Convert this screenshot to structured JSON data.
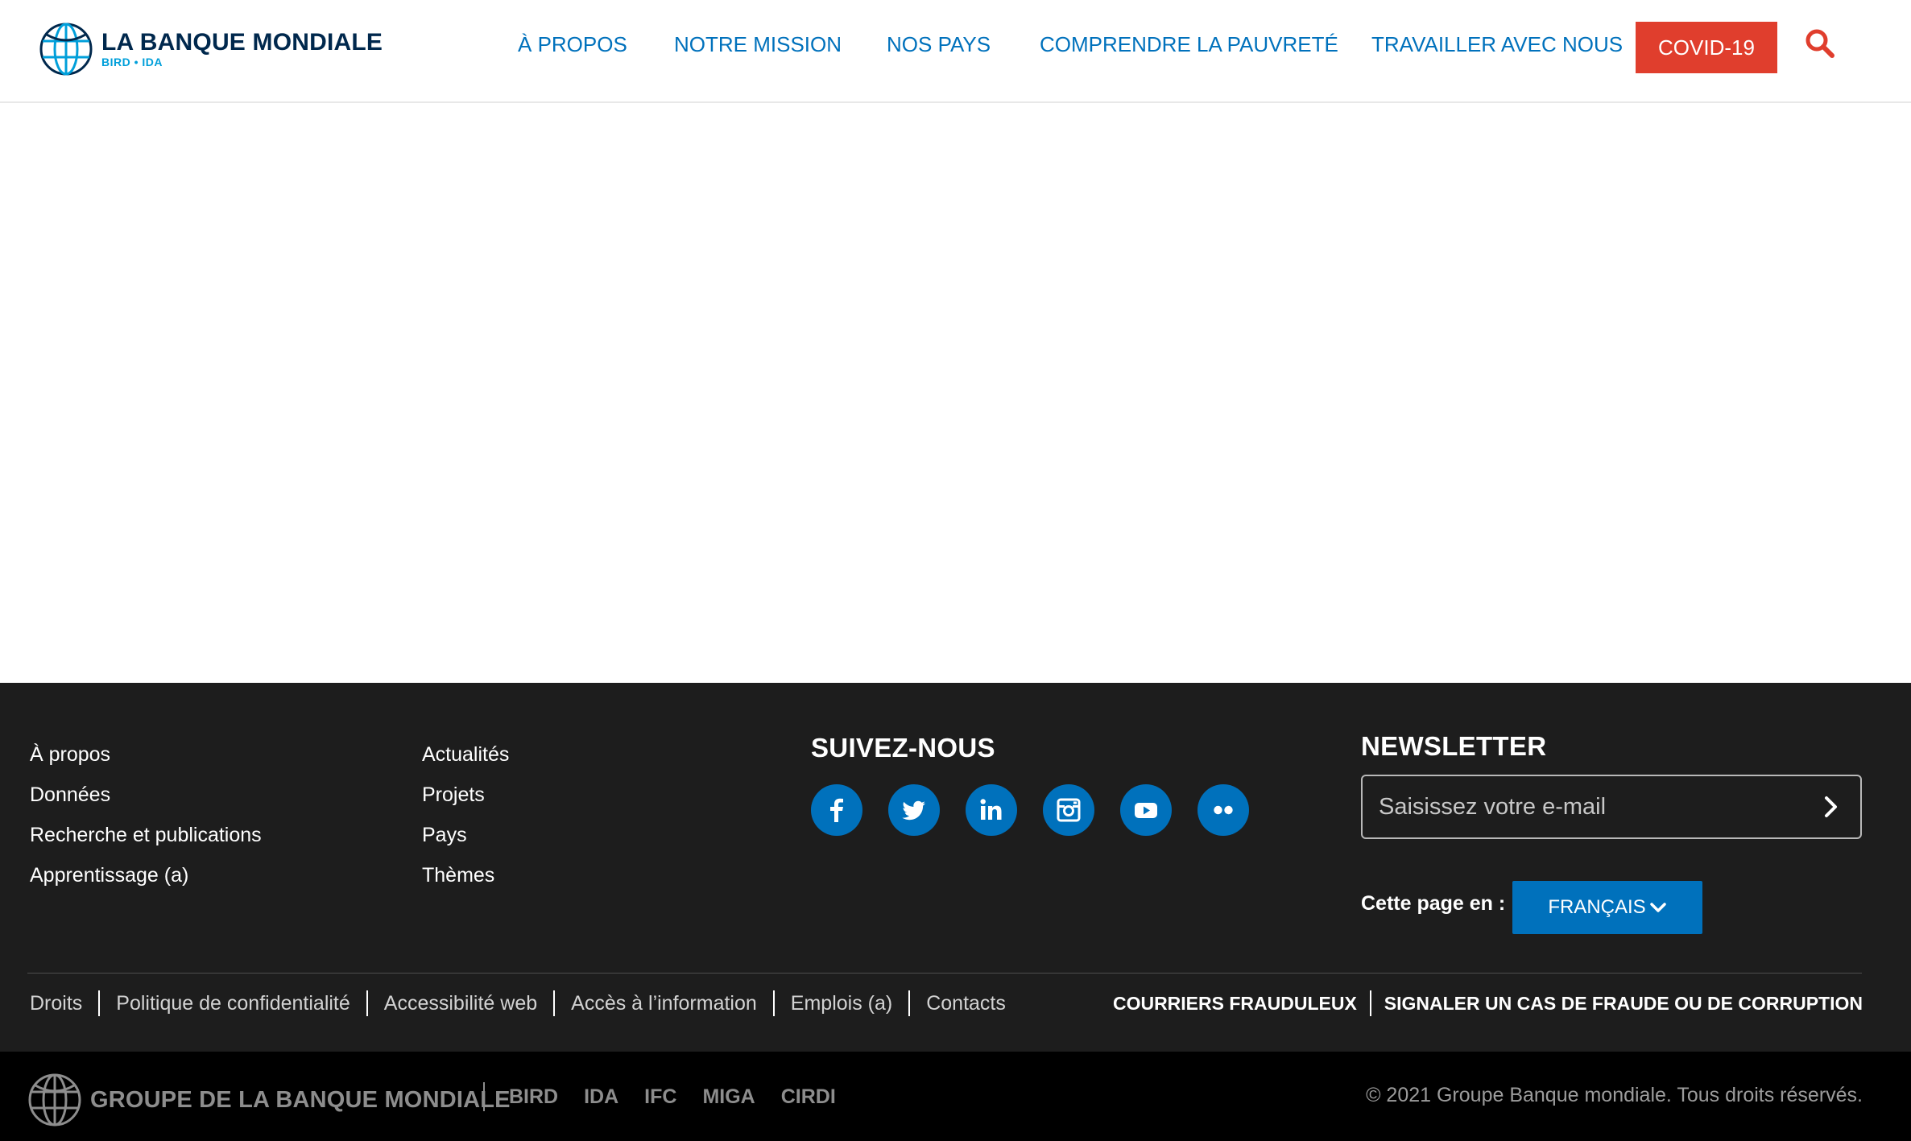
{
  "header": {
    "logo_title": "LA BANQUE MONDIALE",
    "logo_subtitle": "BIRD • IDA",
    "nav": [
      {
        "label": "À PROPOS"
      },
      {
        "label": "NOTRE MISSION"
      },
      {
        "label": "NOS PAYS"
      },
      {
        "label": "COMPRENDRE LA PAUVRETÉ"
      },
      {
        "label": "TRAVAILLER AVEC NOUS"
      }
    ],
    "covid_label": "COVID-19",
    "search_icon": "search-icon"
  },
  "footer": {
    "col1": [
      "À propos",
      "Données",
      "Recherche et publications",
      "Apprentissage (a)"
    ],
    "col2": [
      "Actualités",
      "Projets",
      "Pays",
      "Thèmes"
    ],
    "follow_title": "SUIVEZ-NOUS",
    "socials": [
      "facebook-icon",
      "twitter-icon",
      "linkedin-icon",
      "instagram-icon",
      "youtube-icon",
      "flickr-icon"
    ],
    "newsletter_title": "NEWSLETTER",
    "newsletter_placeholder": "Saisissez votre e-mail",
    "lang_label": "Cette page en :",
    "lang_value": "FRANÇAIS",
    "legal_links": [
      "Droits",
      "Politique de confidentialité",
      "Accessibilité web",
      "Accès à l’information",
      "Emplois (a)",
      "Contacts"
    ],
    "fraud_links": [
      "COURRIERS FRAUDULEUX",
      "SIGNALER UN CAS DE FRAUDE OU DE CORRUPTION"
    ]
  },
  "bottom": {
    "group_name": "GROUPE DE LA BANQUE MONDIALE",
    "institutions": [
      "BIRD",
      "IDA",
      "IFC",
      "MIGA",
      "CIRDI"
    ],
    "copyright": "© 2021 Groupe Banque mondiale. Tous droits réservés."
  },
  "colors": {
    "brand_blue": "#0071bc",
    "covid_red": "#e03e2d",
    "footer_bg": "#1d1d1d",
    "bottom_bg": "#000000"
  }
}
